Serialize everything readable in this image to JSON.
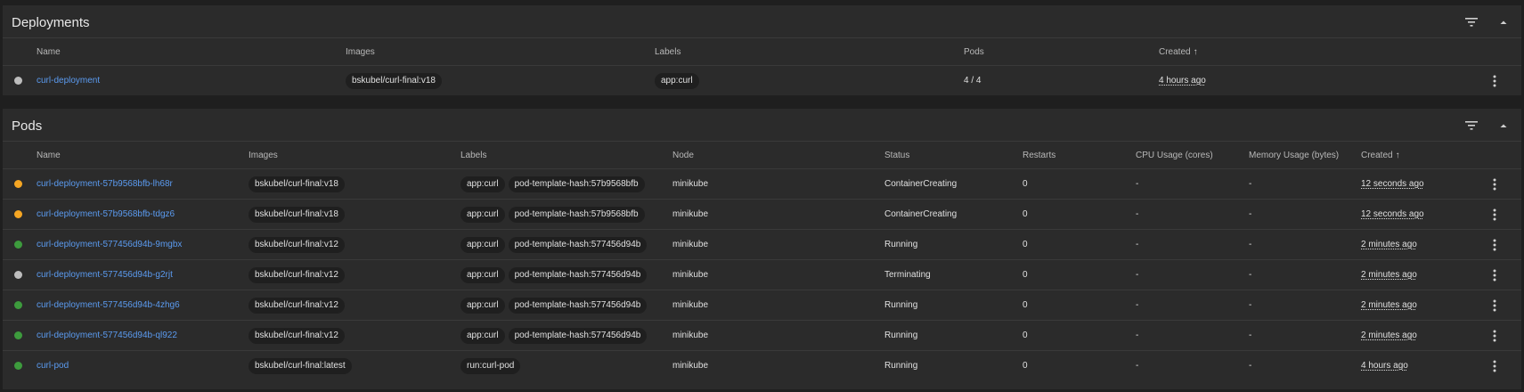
{
  "colors": {
    "card_bg": "#2b2b2b",
    "page_bg": "#1f1f1f",
    "link": "#5b9bf0",
    "status_pending": "#f5a623",
    "status_running": "#3d9b3d",
    "status_terminating": "#bdbdbd"
  },
  "deployments": {
    "title": "Deployments",
    "filter_icon": "filter-icon",
    "collapse_icon": "chevron-up-icon",
    "columns": {
      "name": "Name",
      "images": "Images",
      "labels": "Labels",
      "pods": "Pods",
      "created": "Created",
      "sort_arrow": "↑"
    },
    "rows": [
      {
        "status": "terminating",
        "name": "curl-deployment",
        "image": "bskubel/curl-final:v18",
        "label": "app:curl",
        "pods": "4 / 4",
        "created": "4 hours ago"
      }
    ]
  },
  "pods": {
    "title": "Pods",
    "filter_icon": "filter-icon",
    "collapse_icon": "chevron-up-icon",
    "columns": {
      "name": "Name",
      "images": "Images",
      "labels": "Labels",
      "node": "Node",
      "status": "Status",
      "restarts": "Restarts",
      "cpu": "CPU Usage (cores)",
      "memory": "Memory Usage (bytes)",
      "created": "Created",
      "sort_arrow": "↑"
    },
    "rows": [
      {
        "status": "pending",
        "name": "curl-deployment-57b9568bfb-lh68r",
        "image": "bskubel/curl-final:v18",
        "label1": "app:curl",
        "label2": "pod-template-hash:57b9568bfb",
        "node": "minikube",
        "state": "ContainerCreating",
        "restarts": "0",
        "cpu": "-",
        "memory": "-",
        "created": "12 seconds ago"
      },
      {
        "status": "pending",
        "name": "curl-deployment-57b9568bfb-tdgz6",
        "image": "bskubel/curl-final:v18",
        "label1": "app:curl",
        "label2": "pod-template-hash:57b9568bfb",
        "node": "minikube",
        "state": "ContainerCreating",
        "restarts": "0",
        "cpu": "-",
        "memory": "-",
        "created": "12 seconds ago"
      },
      {
        "status": "running",
        "name": "curl-deployment-577456d94b-9mgbx",
        "image": "bskubel/curl-final:v12",
        "label1": "app:curl",
        "label2": "pod-template-hash:577456d94b",
        "node": "minikube",
        "state": "Running",
        "restarts": "0",
        "cpu": "-",
        "memory": "-",
        "created": "2 minutes ago"
      },
      {
        "status": "terminating",
        "name": "curl-deployment-577456d94b-g2rjt",
        "image": "bskubel/curl-final:v12",
        "label1": "app:curl",
        "label2": "pod-template-hash:577456d94b",
        "node": "minikube",
        "state": "Terminating",
        "restarts": "0",
        "cpu": "-",
        "memory": "-",
        "created": "2 minutes ago"
      },
      {
        "status": "running",
        "name": "curl-deployment-577456d94b-4zhg6",
        "image": "bskubel/curl-final:v12",
        "label1": "app:curl",
        "label2": "pod-template-hash:577456d94b",
        "node": "minikube",
        "state": "Running",
        "restarts": "0",
        "cpu": "-",
        "memory": "-",
        "created": "2 minutes ago"
      },
      {
        "status": "running",
        "name": "curl-deployment-577456d94b-ql922",
        "image": "bskubel/curl-final:v12",
        "label1": "app:curl",
        "label2": "pod-template-hash:577456d94b",
        "node": "minikube",
        "state": "Running",
        "restarts": "0",
        "cpu": "-",
        "memory": "-",
        "created": "2 minutes ago"
      },
      {
        "status": "running",
        "name": "curl-pod",
        "image": "bskubel/curl-final:latest",
        "label1": "run:curl-pod",
        "label2": "",
        "node": "minikube",
        "state": "Running",
        "restarts": "0",
        "cpu": "-",
        "memory": "-",
        "created": "4 hours ago"
      }
    ]
  }
}
